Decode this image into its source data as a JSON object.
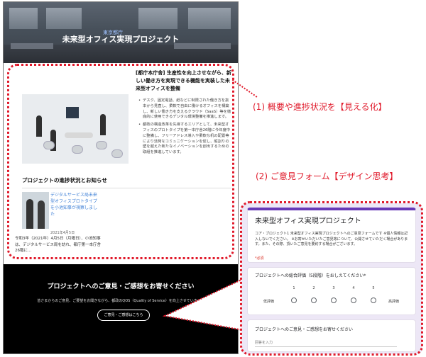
{
  "hero": {
    "sub_label": "東京都庁",
    "title": "未来型オフィス実現プロジェクト"
  },
  "intro": {
    "heading": "[都庁本庁舎] 生産性を向上させながら、新しい働き方を実現できる機能を実装した未来型オフィスを整備",
    "bullets": [
      "デスク、固定電話、紙などに制限された働き方を抜本から見直し、柔軟で自由に働けるオフィスを構築し、新しい働き方を支えるクラウド（SaaS）等を徹底的に使用できるデジタル環境整備を推進します。",
      "都政の構造改革を先導するエリアとして、未来型オフィスのプロトタイプを第一本庁舎26階に今年度中に整備し、フリーアドレス導入や柔軟な机の配置等により活発なコミュニケーションを促し、縦割りの壁を越えた新たなイノベーションを創出するための取組を推進しています。"
    ]
  },
  "progress": {
    "heading": "プロジェクトの進捗状況とお知らせ",
    "news_title": "デジタルサービス局未来型オフィスプロトタイプを小池知事が視察しました",
    "news_date": "2021年4月5日",
    "news_excerpt": "令和3年（2021年）4月5日（月曜日）、小池知事は、デジタルサービス局を訪れ、都庁第一本庁舎26階に..."
  },
  "feedback": {
    "title": "プロジェクトへのご意見・ご感想をお寄せください",
    "body": "皆さまからのご意見、ご要望をお聞きながら、都政のQOS（Quality of Service）を向上させていきます",
    "button": "ご意見・ご感想はこちら"
  },
  "callouts": {
    "c1": "(1) 概要や進捗状況を【見える化】",
    "c2": "(2) ご意見フォーム【デザイン思考】"
  },
  "form": {
    "title": "未来型オフィス実現プロジェクト",
    "desc": "コア・プロジェクト1  未来型オフィス実現プロジェクトへのご意見フォームです ※個人情報は記入しないでください。 ※お寄せいただいたご意見等について、公開させていただく場合があります。また、その際、頂いたご意見を要約する場合がございます。",
    "required": "*必須",
    "q1": {
      "label": "プロジェクトへの総合評価（5段階）をおしえてください*",
      "scale": [
        "1",
        "2",
        "3",
        "4",
        "5"
      ],
      "low": "低評価",
      "high": "高評価"
    },
    "q2": {
      "label": "プロジェクトへのご意見・ご感想をお寄せください",
      "placeholder": "回答を入力"
    }
  },
  "colors": {
    "accent_red": "#e0192a",
    "form_purple": "#673ab7"
  }
}
